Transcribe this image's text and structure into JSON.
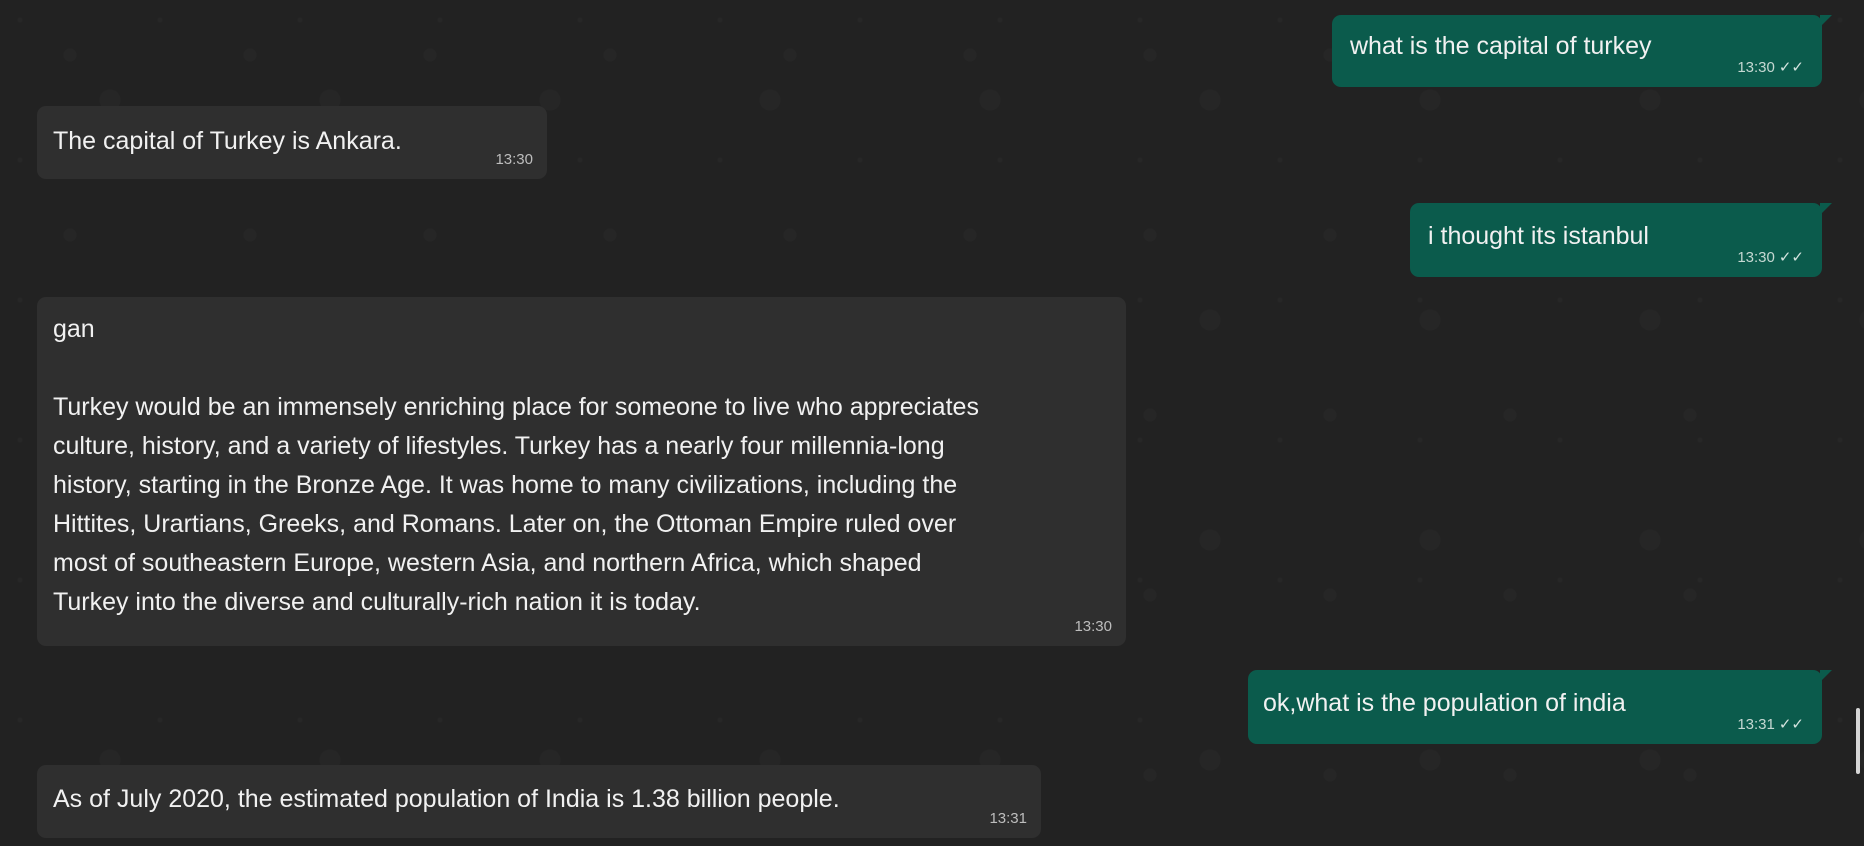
{
  "messages": [
    {
      "sender": "me",
      "text": "what is the capital of turkey",
      "time": "13:30",
      "status": "double-check-icon"
    },
    {
      "sender": "them",
      "text": "The capital of Turkey is Ankara.",
      "time": "13:30"
    },
    {
      "sender": "me",
      "text": "i thought its istanbul",
      "time": "13:30",
      "status": "double-check-icon"
    },
    {
      "sender": "them",
      "text": "gan\n\nTurkey would be an immensely enriching place for someone to live who appreciates\nculture, history, and a variety of lifestyles. Turkey has a nearly four millennia-long\nhistory, starting in the Bronze Age. It was home to many civilizations, including the\nHittites, Urartians, Greeks, and Romans. Later on, the Ottoman Empire ruled over\nmost of southeastern Europe, western Asia, and northern Africa, which shaped\nTurkey into the diverse and culturally-rich nation it is today.",
      "time": "13:30"
    },
    {
      "sender": "me",
      "text": "ok,what is the population of india",
      "time": "13:31",
      "status": "double-check-icon"
    },
    {
      "sender": "them",
      "text": "As of July 2020, the estimated population of India is 1.38 billion people.",
      "time": "13:31"
    }
  ],
  "colors": {
    "background": "#222222",
    "incoming_bubble": "#2f2f2f",
    "outgoing_bubble": "#0b5b4c",
    "text": "#f1f1f1"
  }
}
